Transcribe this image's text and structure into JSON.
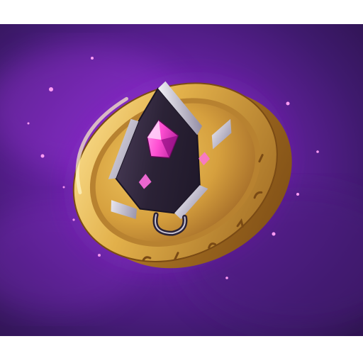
{
  "scene": {
    "subject": "coin-icon",
    "colors": {
      "background_deep": "#3a1460",
      "background_mid": "#6a22a8",
      "background_glow": "#b03ee0",
      "gold_light": "#f2cf6a",
      "gold_mid": "#d9a53a",
      "gold_dark": "#8a5a1a",
      "emblem_dark": "#2b2236",
      "emblem_silver": "#c9c4d4",
      "gem_pink": "#ff5fd8",
      "gem_magenta": "#c21aa8"
    }
  }
}
